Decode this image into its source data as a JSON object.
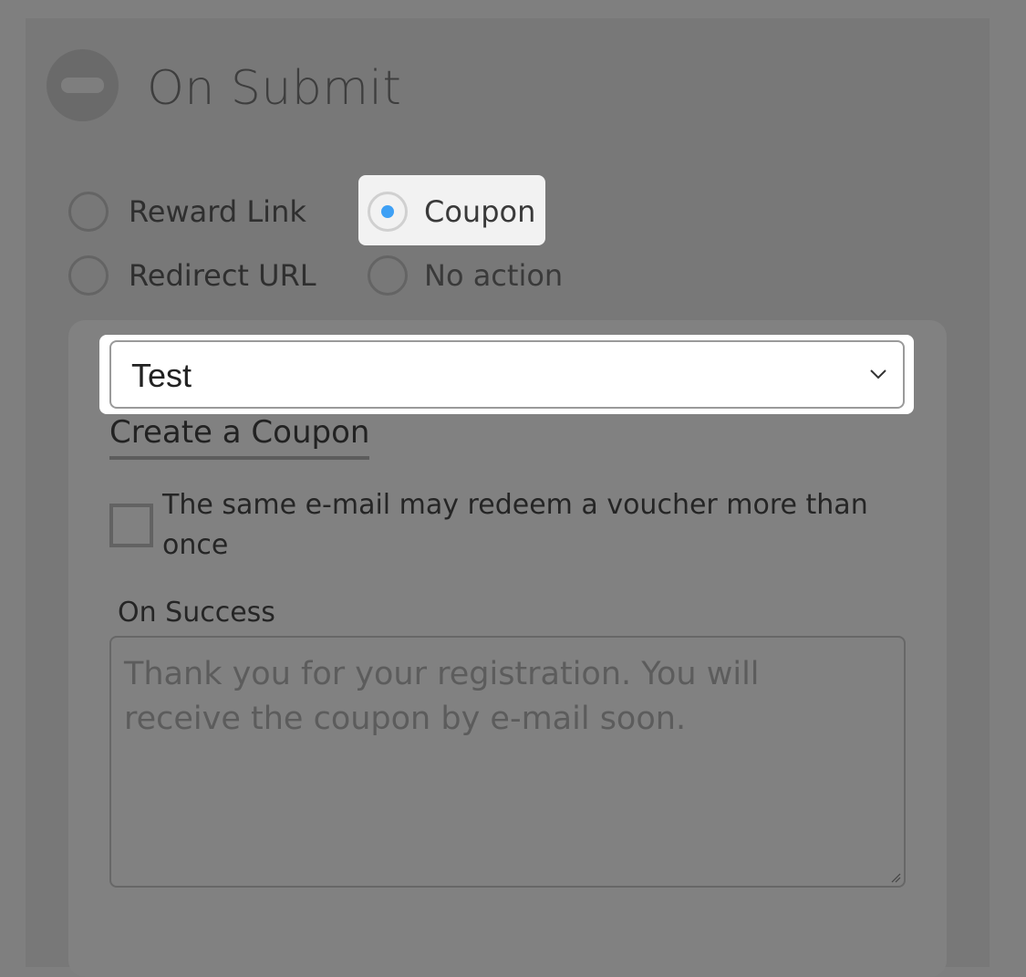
{
  "section": {
    "title": "On Submit",
    "collapse_icon": "minus-circle-icon"
  },
  "actions": {
    "options": [
      {
        "label": "Reward Link",
        "selected": false
      },
      {
        "label": "Coupon",
        "selected": true
      },
      {
        "label": "Redirect URL",
        "selected": false
      },
      {
        "label": "No action",
        "selected": false
      }
    ]
  },
  "coupon": {
    "selected_value": "Test",
    "create_link_label": "Create a Coupon",
    "allow_multiple_label": "The same e-mail may redeem a voucher more than once",
    "allow_multiple_checked": false,
    "on_success_label": "On Success",
    "on_success_placeholder": "Thank you for your registration. You will receive the coupon by e-mail soon.",
    "on_success_value": ""
  },
  "colors": {
    "accent": "#3ea0f5",
    "overlay": "#7f7f7f"
  }
}
